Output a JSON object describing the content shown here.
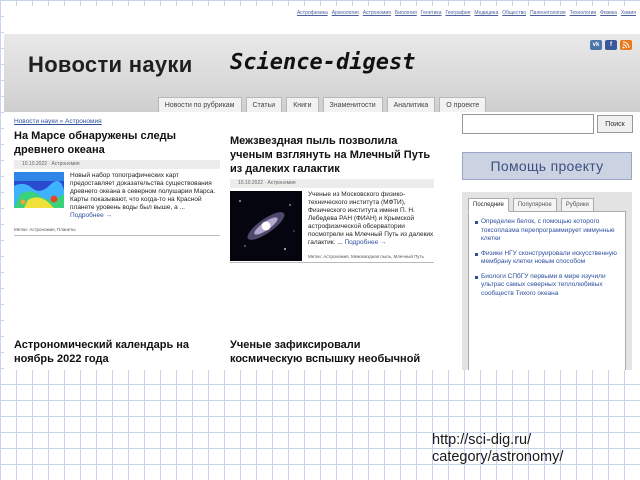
{
  "top_nav": [
    "Астрофизика",
    "Археология",
    "Астрономия",
    "Биология",
    "Генетика",
    "География",
    "Медицина",
    "Общество",
    "Палеонтология",
    "Технологии",
    "Физика",
    "Химия"
  ],
  "header": {
    "logo_ru": "Новости науки",
    "logo_en": "Science-digest",
    "social": [
      "vk",
      "f"
    ],
    "colors": {
      "vk": "#4a76a8",
      "fb": "#3b5998",
      "rss": "#e87a1d"
    }
  },
  "menu": [
    "Новости по рубрикам",
    "Статьи",
    "Книги",
    "Знаменитости",
    "Аналитика",
    "О проекте"
  ],
  "breadcrumb": "Новости науки » Астрономия",
  "articles": [
    {
      "title": "На Марсе обнаружены следы древнего океана",
      "meta": "10.10.2022 · Астрономия",
      "lead": "Новый набор топографических карт предоставляет доказательства существования древнего океана в северном полушарии Марса. Карты показывают, что когда-то на Красной планете уровень воды был выше, а ...",
      "more": "Подробнее →",
      "tags": "Метки: Астрономия, Планеты"
    },
    {
      "title": "Межзвездная пыль позволила ученым взглянуть на Млечный Путь из далеких галактик",
      "meta": "10.10.2022 · Астрономия",
      "lead": "Ученые из Московского физико-технического института (МФТИ), Физического института имени П. Н. Лебедева РАН (ФИАН) и Крымской астрофизической обсерватории посмотрели на Млечный Путь из далеких галактик. ...",
      "more": "Подробнее →",
      "tags": "Метки: Астрономия, Межзвездная пыль, Млечный Путь"
    },
    {
      "title": "Астрономический календарь на ноябрь 2022 года"
    },
    {
      "title": "Ученые зафиксировали космическую вспышку необычной"
    }
  ],
  "sidebar": {
    "search_button": "Поиск",
    "help_banner": "Помощь проекту",
    "tabs": [
      "Последние",
      "Популярное",
      "Рубрики"
    ],
    "items": [
      "Определен белок, с помощью которого токсоплазма перепрограммирует иммунные клетки",
      "Физики НГУ сконструировали искусственную мембрану клетки новым способом",
      "Биологи СПбГУ первыми в мире изучили ультрас самых северных теплолюбивых сообществ Тихого океана"
    ]
  },
  "caption_url": [
    "http://sci-dig.ru/",
    "category/astronomy/"
  ]
}
